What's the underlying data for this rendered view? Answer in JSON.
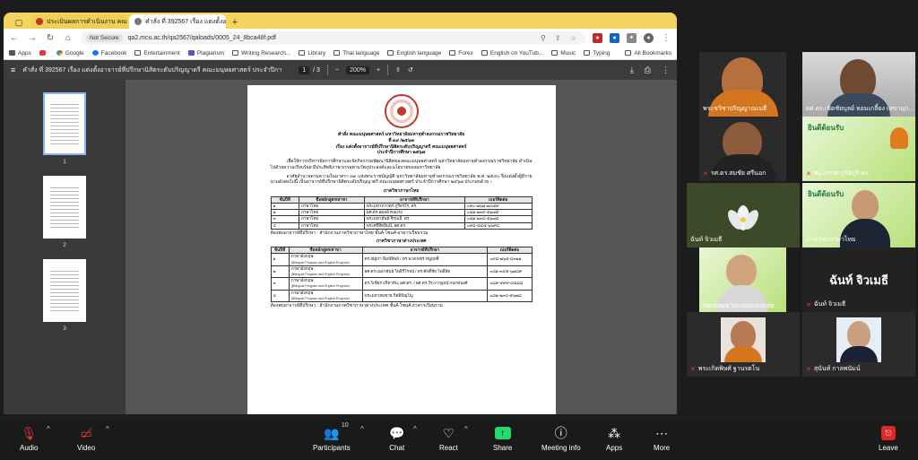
{
  "browser": {
    "tabs": [
      {
        "label": "ประเมินผลการดำเนินงาน คณะมนุษยศาสตร์"
      },
      {
        "label": "คำสั่ง ที่ 392567 เรื่อง แต่งตั้งอาจารย์"
      }
    ],
    "address": {
      "security": "Not Secure",
      "url": "qa2.mcu.ac.th/qa2567/qaloads/0005_24_8bca48f.pdf"
    },
    "bookmarks": [
      {
        "label": "Apps",
        "icon": "apps-icon"
      },
      {
        "label": "",
        "icon": "youtube-icon"
      },
      {
        "label": "Google",
        "icon": "google-icon"
      },
      {
        "label": "Facebook",
        "icon": "facebook-icon"
      },
      {
        "label": "Entertainment",
        "icon": "folder-icon"
      },
      {
        "label": "Plagiarism",
        "icon": "folder-icon"
      },
      {
        "label": "Writing Research...",
        "icon": "folder-icon"
      },
      {
        "label": "Library",
        "icon": "folder-icon"
      },
      {
        "label": "Thai language",
        "icon": "folder-icon"
      },
      {
        "label": "English language",
        "icon": "folder-icon"
      },
      {
        "label": "Forex",
        "icon": "folder-icon"
      },
      {
        "label": "English on YouTub...",
        "icon": "folder-icon"
      },
      {
        "label": "Music",
        "icon": "folder-icon"
      },
      {
        "label": "Typing",
        "icon": "folder-icon"
      }
    ],
    "all_bookmarks": "All Bookmarks"
  },
  "pdf": {
    "title": "คำสั่ง ที่ 392567 เรื่อง แต่งตั้งอาจารย์ที่ปรึกษานิสิตระดับปริญญาตรี คณะมนุษยศาสตร์ ประจำปีการศึกษ...",
    "current_page": "1",
    "total_pages": "/ 3",
    "zoom": "200%",
    "thumbnails": [
      "1",
      "2",
      "3"
    ],
    "document": {
      "header1": "คำสั่ง คณะมนุษยศาสตร์ มหาวิทยาลัยมหาจุฬาลงกรณราชวิทยาลัย",
      "header2": "ที่ ๓๙ /๒๕๖๗",
      "header3": "เรื่อง แต่งตั้งอาจารย์ที่ปรึกษานิสิตระดับปริญญาตรี คณะมนุษยศาสตร์",
      "header4": "ประจำปีการศึกษา ๒๕๖๗",
      "para1": "เพื่อให้การบริหารจัดการศึกษาและจัดกิจกรรมพัฒนานิสิตของคณะมนุษยศาสตร์ มหาวิทยาลัยมหาจุฬาลงกรณราชวิทยาลัย ดำเนินไปด้วยความเรียบร้อย มีประสิทธิภาพ บรรลุตามวัตถุประสงค์และนโยบายของมหาวิทยาลัย",
      "para2": "อาศัยอำนาจตามความในมาตรา ๓๓ แห่งพระราชบัญญัติ มหาวิทยาลัยมหาจุฬาลงกรณราชวิทยาลัย พ.ศ. ๒๕๔๐ จึงแต่งตั้งผู้มีรายนามดังต่อไปนี้ เป็นอาจารย์ที่ปรึกษานิสิตระดับปริญญาตรี คณะมนุษยศาสตร์ ประจำปีการศึกษา ๒๕๖๗ ประกอบด้วย :-",
      "section1": "ภาควิชาภาษาไทย",
      "table_headers": [
        "ชั้นปีที่",
        "ชื่อหลักสูตร/สาขา",
        "อาจารย์ที่ปรึกษา",
        "เบอร์ติดต่อ"
      ],
      "table1": [
        [
          "๑",
          "ภาษาไทย",
          "พระมหาภาวดร ภูริสรโร, ดร.",
          "๐๙๐-๗๖๗-๗๘๕๙"
        ],
        [
          "๒",
          "ภาษาไทย",
          "ผศ.ดร.อดุลย์ คนแรง",
          "๐๘๑-๒๓๔-๕๖๗๘"
        ],
        [
          "๓",
          "ภาษาไทย",
          "พระมหาสันต์ จิรเมธี, ดร.",
          "๐๘๑-๒๓๔-๕๖๗๘"
        ],
        [
          "๔",
          "ภาษาไทย",
          "พระศรีสิทธิมุนี, ผศ.ดร.",
          "๐๙๔-๘๔๕-๖๖๙๘"
        ]
      ],
      "location1": "ห้องพบอาจารย์ที่ปรึกษา : สำนักงานภาควิชาภาษาไทย ชั้นA โซนA อาคารเรียนรวม",
      "section2": "ภาควิชาภาษาต่างประเทศ",
      "table2": [
        [
          "๑",
          "ภาษาอังกฤษ",
          "(Bilingual Program and English Program)",
          "ดร.ณัฐภา พิมพ์ทิพย์ / ดร.พวงเพชร หนูฤทธิ์",
          "๐๙๘-๗๖๕-๔๓๒๑"
        ],
        [
          "๒",
          "ภาษาอังกฤษ",
          "(Bilingual Program and English Program)",
          "ผศ.ดร.เฉลาพันธ์ ไพธิรีโรจน์ / ดร.ศักดิ์ชัย โพธิ์สัย",
          "๐๘๑-๓๔๕-๖๗๘๙"
        ],
        [
          "๓",
          "ภาษาอังกฤษ",
          "(Bilingual Program and English Program)",
          "ดร.วิเชียร ปริยาทัน, ผศ.ดร. / ผศ.ดร.วีระกาญจน์ กนกทนงศ์",
          "๐๘๙-๙๙๙-๘๘๘๘"
        ],
        [
          "๔",
          "ภาษาอังกฤษ",
          "(Bilingual Program and English Program)",
          "พระมหาสมชาย กิตติปัญโญ",
          "๐๘๑-๒๓๔-๕๖๗๘"
        ]
      ],
      "location2": "ห้องพบอาจารย์ที่ปรึกษา : สำนักงานภาควิชาภาษาต่างประเทศ ชั้นA โซนA อาคารเรียนรวม"
    }
  },
  "gallery": [
    {
      "name": "พระชวิชาปริญญาณเมธี"
    },
    {
      "name": "ผศ.ดร.เชิดชัยบุลย์ หอมเกลี้ยง เลขานุก..."
    },
    {
      "name": "รศ.ดร.สมชัย ศรีนอก"
    },
    {
      "name": "พม.การศ ภูริสภูริ.ดร."
    },
    {
      "name": "ฉันท์ จิวเมธี"
    },
    {
      "name": "ภาควิชาภาษาไทย"
    },
    {
      "name": "Varasaya Varasayananda"
    },
    {
      "name": "ฉันท์ จิวเมธี"
    },
    {
      "name": "พระเกิดพิษศ์ ฐานรตโน"
    },
    {
      "name": "สุนันท์ กาลพนัมน์"
    }
  ],
  "gallery_texts": {
    "banner": "ยินดีต้อนรับ",
    "bigname": "ฉันท์ จิวเมธี"
  },
  "toolbar": {
    "audio": "Audio",
    "video": "Video",
    "participants": "Participants",
    "participant_count": "10",
    "chat": "Chat",
    "react": "React",
    "share": "Share",
    "meeting_info": "Meeting info",
    "apps": "Apps",
    "more": "More",
    "leave": "Leave"
  },
  "colors": {
    "tabbar": "#f4d35e",
    "active_speaker": "#23d96b",
    "share": "#23d96b",
    "leave": "#e02828",
    "muted": "#e53935"
  }
}
